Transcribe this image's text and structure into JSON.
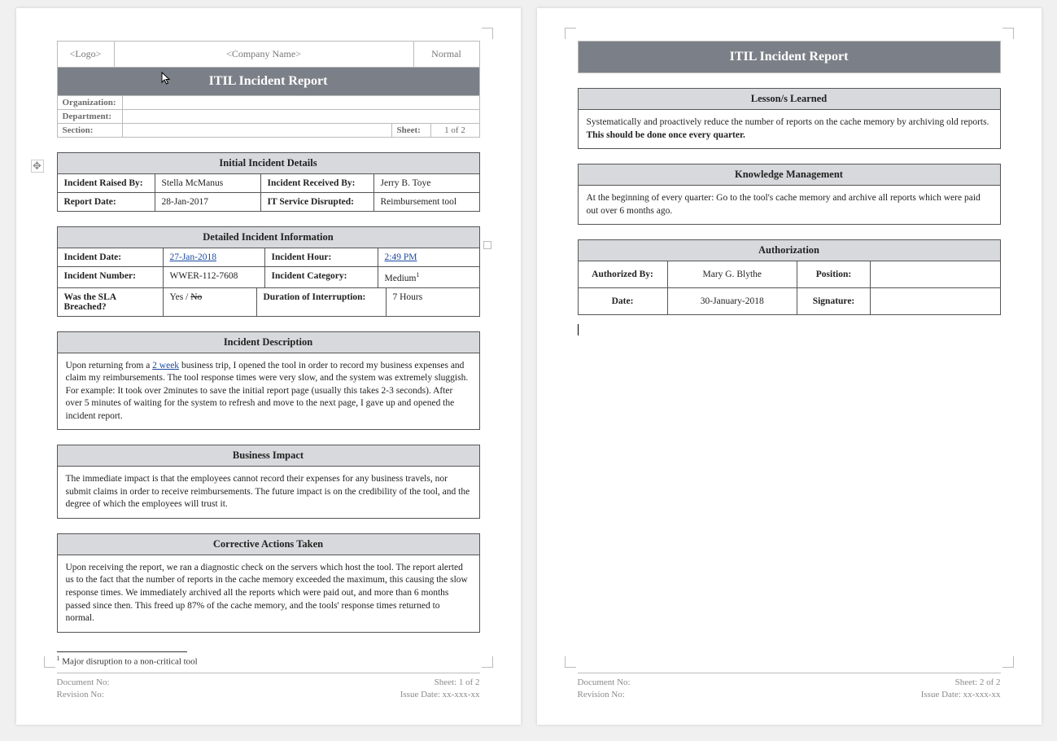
{
  "header": {
    "logo_placeholder": "<Logo>",
    "company_placeholder": "<Company Name>",
    "normal_label": "Normal",
    "title": "ITIL Incident Report",
    "org_label": "Organization:",
    "dept_label": "Department:",
    "section_label": "Section:",
    "sheet_label": "Sheet:",
    "sheet_value": "1 of 2"
  },
  "initial": {
    "head": "Initial Incident Details",
    "raised_by_l": "Incident Raised By:",
    "raised_by_v": "Stella McManus",
    "received_by_l": "Incident Received By:",
    "received_by_v": "Jerry B. Toye",
    "report_date_l": "Report Date:",
    "report_date_v": "28-Jan-2017",
    "service_l": "IT Service Disrupted:",
    "service_v": "Reimbursement tool"
  },
  "detail": {
    "head": "Detailed Incident Information",
    "date_l": "Incident Date:",
    "date_v": "27-Jan-2018",
    "hour_l": "Incident Hour:",
    "hour_v": "2:49 PM",
    "num_l": "Incident Number:",
    "num_v": "WWER-112-7608",
    "cat_l": "Incident Category:",
    "cat_v": "Medium",
    "cat_sup": "1",
    "sla_l": "Was the SLA Breached?",
    "sla_yes": "Yes / ",
    "sla_no": "No",
    "dur_l": "Duration of Interruption:",
    "dur_v": "7 Hours"
  },
  "desc": {
    "head": "Incident Description",
    "pre": "Upon returning from a ",
    "link": "2 week",
    "post": " business trip, I opened the tool in order to record my business expenses and claim my reimbursements. The tool response times were very slow, and the system was extremely sluggish. For example: It took over 2minutes to save the initial report page (usually this takes 2-3 seconds). After over 5 minutes of waiting for the system to refresh and move to the next page, I gave up and opened the incident report."
  },
  "impact": {
    "head": "Business Impact",
    "body": "The immediate impact is that the employees cannot record their expenses for any business travels, nor submit claims in order to receive reimbursements. The future impact is on the credibility of the tool, and the degree of which the employees will trust it."
  },
  "corrective": {
    "head": "Corrective Actions Taken",
    "body": "Upon receiving the report, we ran a diagnostic check on the servers which host the tool. The report alerted us to the fact that the number of reports in the cache memory exceeded the maximum, this causing the slow response times. We immediately archived all the reports which were paid out, and more than 6 months passed since then. This freed up 87% of the cache memory, and the tools' response times returned to normal."
  },
  "footnote": {
    "sup": "1",
    "text": " Major disruption to a non-critical tool"
  },
  "footer1": {
    "doc_no": "Document No:",
    "rev_no": "Revision No:",
    "sheet": "Sheet: 1 of 2",
    "issue": "Issue Date: xx-xxx-xx"
  },
  "page2title": "ITIL Incident Report",
  "lessons": {
    "head": "Lesson/s Learned",
    "pre": "Systematically and proactively reduce the number of reports on the cache memory by archiving old reports. ",
    "bold": "This should be done once every quarter."
  },
  "knowledge": {
    "head": "Knowledge Management",
    "body": "At the beginning of every quarter: Go to the tool's cache memory and archive all reports which were paid out over 6 months ago."
  },
  "auth": {
    "head": "Authorization",
    "by_l": "Authorized By:",
    "by_v": "Mary G. Blythe",
    "pos_l": "Position:",
    "pos_v": "",
    "date_l": "Date:",
    "date_v": "30-January-2018",
    "sig_l": "Signature:",
    "sig_v": ""
  },
  "footer2": {
    "doc_no": "Document No:",
    "rev_no": "Revision No:",
    "sheet": "Sheet: 2 of 2",
    "issue": "Issue Date: xx-xxx-xx"
  }
}
